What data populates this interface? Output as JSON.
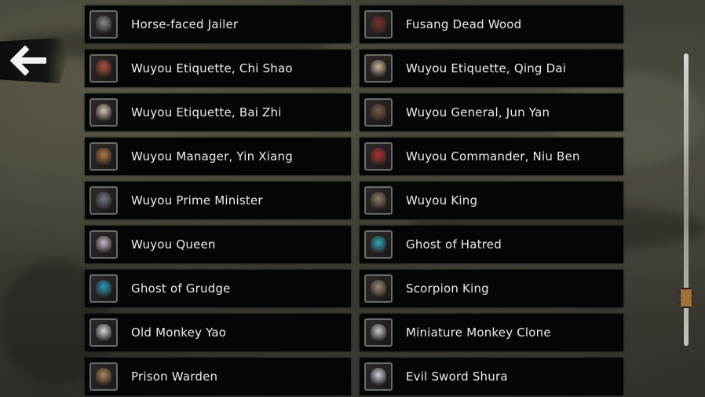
{
  "back_icon": "arrow-left-icon",
  "entries": [
    {
      "left": {
        "name": "Horse-faced Jailer",
        "tint": "#8a8a8a"
      },
      "right": {
        "name": "Fusang Dead Wood",
        "tint": "#7a3030"
      }
    },
    {
      "left": {
        "name": "Wuyou Etiquette, Chi Shao",
        "tint": "#b05040"
      },
      "right": {
        "name": "Wuyou Etiquette, Qing Dai",
        "tint": "#c7b59a"
      }
    },
    {
      "left": {
        "name": "Wuyou Etiquette, Bai Zhi",
        "tint": "#d0c6b8"
      },
      "right": {
        "name": "Wuyou General, Jun Yan",
        "tint": "#7a5a4a"
      }
    },
    {
      "left": {
        "name": "Wuyou Manager, Yin Xiang",
        "tint": "#b67848"
      },
      "right": {
        "name": "Wuyou Commander, Niu Ben",
        "tint": "#b03030"
      }
    },
    {
      "left": {
        "name": "Wuyou Prime Minister",
        "tint": "#6e7a8a"
      },
      "right": {
        "name": "Wuyou King",
        "tint": "#8a8070"
      }
    },
    {
      "left": {
        "name": "Wuyou Queen",
        "tint": "#c8b8c8"
      },
      "right": {
        "name": "Ghost of Hatred",
        "tint": "#2aa8b8"
      }
    },
    {
      "left": {
        "name": "Ghost of Grudge",
        "tint": "#2a9ac0"
      },
      "right": {
        "name": "Scorpion King",
        "tint": "#9a8a70"
      }
    },
    {
      "left": {
        "name": "Old Monkey Yao",
        "tint": "#d8d8d8"
      },
      "right": {
        "name": "Miniature Monkey Clone",
        "tint": "#c8c8c8"
      }
    },
    {
      "left": {
        "name": "Prison Warden",
        "tint": "#b08a5a"
      },
      "right": {
        "name": "Evil Sword Shura",
        "tint": "#d0d0e0"
      }
    }
  ],
  "scroll_position": 0.86
}
